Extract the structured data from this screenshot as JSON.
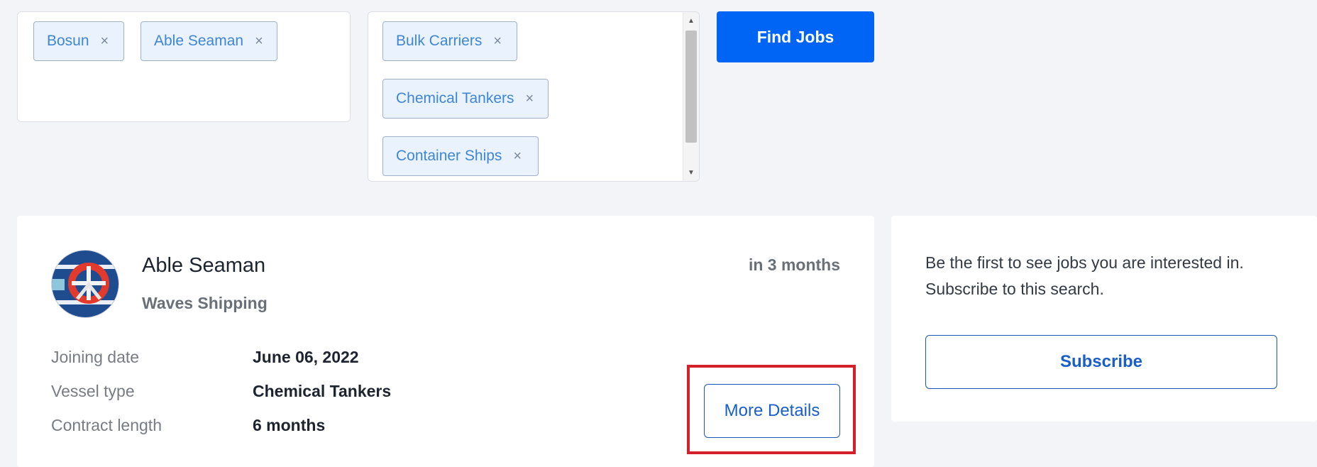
{
  "filters": {
    "ranks": [
      {
        "label": "Bosun",
        "remove": "×"
      },
      {
        "label": "Able Seaman",
        "remove": "×"
      }
    ],
    "vessels": [
      {
        "label": "Bulk Carriers",
        "remove": "×"
      },
      {
        "label": "Chemical Tankers",
        "remove": "×"
      },
      {
        "label": "Container Ships",
        "remove": "×"
      }
    ],
    "find_label": "Find Jobs"
  },
  "job": {
    "title": "Able Seaman",
    "company": "Waves Shipping",
    "posted": "in 3 months",
    "details": [
      {
        "label": "Joining date",
        "value": "June 06, 2022"
      },
      {
        "label": "Vessel type",
        "value": "Chemical Tankers"
      },
      {
        "label": "Contract length",
        "value": "6 months"
      }
    ],
    "more_label": "More Details"
  },
  "subscribe": {
    "text": "Be the first to see jobs you are interested in. Subscribe to this search.",
    "button_label": "Subscribe"
  },
  "colors": {
    "primary": "#0064f5",
    "highlight": "#d3202a",
    "chip_bg": "#eaf2fd",
    "chip_text": "#3f86d6"
  }
}
